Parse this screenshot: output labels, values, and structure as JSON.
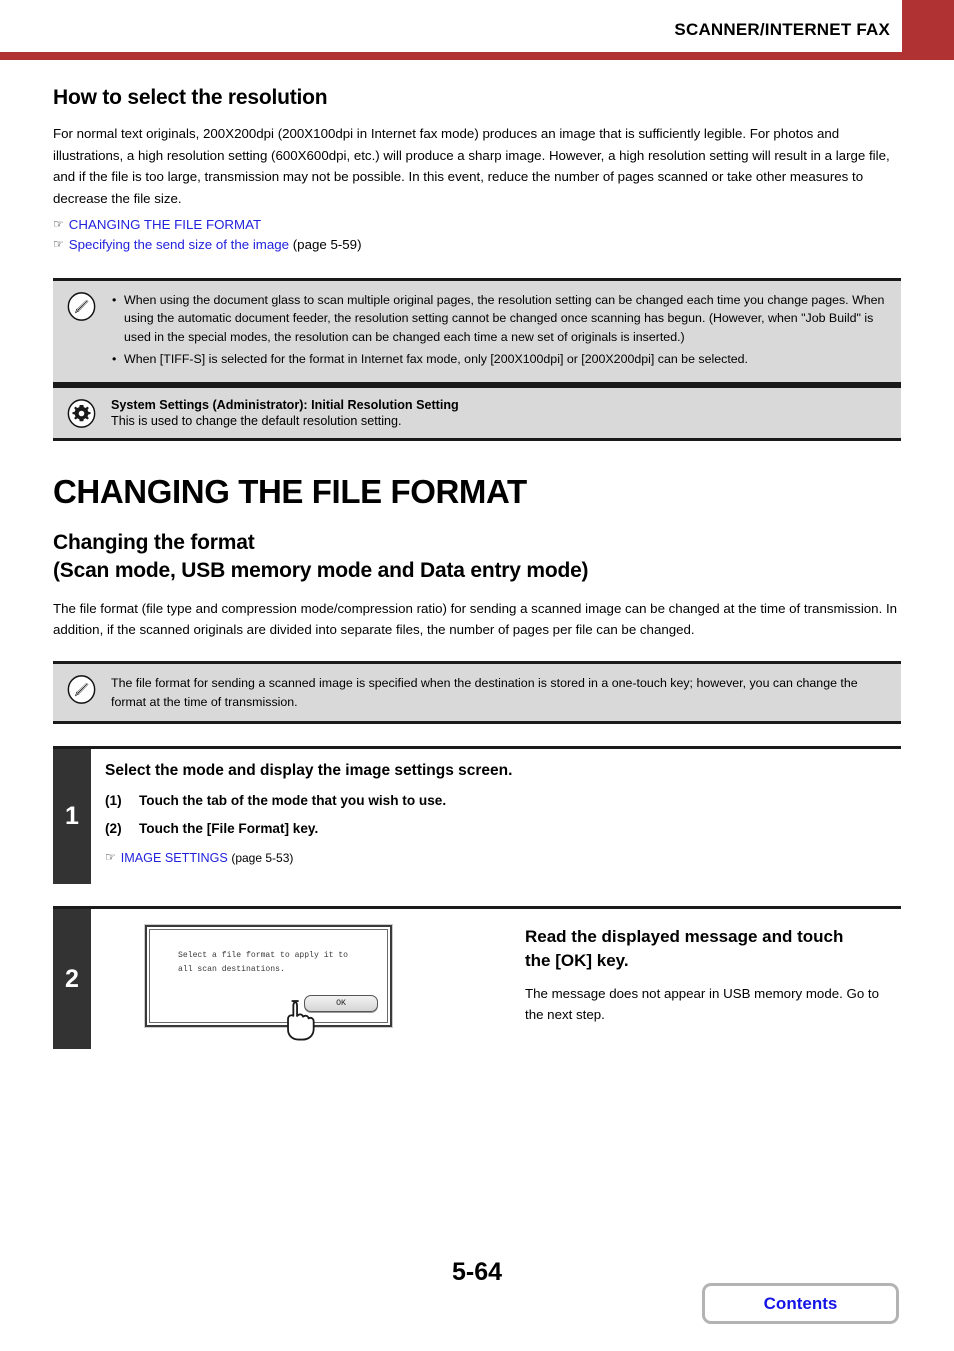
{
  "header": {
    "title": "SCANNER/INTERNET FAX",
    "accent_color": "#b03232"
  },
  "resolution_section": {
    "heading": "How to select the resolution",
    "paragraph": "For normal text originals, 200X200dpi (200X100dpi in Internet fax mode) produces an image that is sufficiently legible. For photos and illustrations, a high resolution setting (600X600dpi, etc.) will produce a sharp image. However, a high resolution setting will result in a large file, and if the file is too large, transmission may not be possible. In this event, reduce the number of pages scanned or take other measures to decrease the file size.",
    "links": [
      {
        "pointer": "☞",
        "label": "CHANGING THE FILE FORMAT",
        "page": ""
      },
      {
        "pointer": "☞",
        "label": "Specifying the send size of the image",
        "page": "(page 5-59)"
      }
    ]
  },
  "note_box_1": {
    "icon": "pencil-note-icon",
    "bullets": [
      "When using the document glass to scan multiple original pages, the resolution setting can be changed each time you change pages. When using the automatic document feeder, the resolution setting cannot be changed once scanning has begun. (However, when \"Job Build\" is used in the special modes, the resolution can be changed each time a new set of originals is inserted.)",
      "When [TIFF-S] is selected for the format in Internet fax mode, only [200X100dpi] or [200X200dpi] can be selected."
    ]
  },
  "admin_box": {
    "icon": "gear-icon",
    "title": "System Settings (Administrator): Initial Resolution Setting",
    "text": "This is used to change the default resolution setting."
  },
  "file_format_section": {
    "main_heading": "CHANGING THE FILE FORMAT",
    "sub_heading_line1": "Changing the format",
    "sub_heading_line2": "(Scan mode, USB memory mode and Data entry mode)",
    "paragraph": "The file format (file type and compression mode/compression ratio) for sending a scanned image can be changed at the time of transmission. In addition, if the scanned originals are divided into separate files, the number of pages per file can be changed."
  },
  "note_box_2": {
    "icon": "pencil-note-icon",
    "text": "The file format for sending a scanned image is specified when the destination is stored in a one-touch key; however, you can change the format at the time of transmission."
  },
  "steps": [
    {
      "number": "1",
      "heading": "Select the mode and display the image settings screen.",
      "substeps": [
        {
          "index": "(1)",
          "text": "Touch the tab of the mode that you wish to use."
        },
        {
          "index": "(2)",
          "text": "Touch the [File Format] key."
        }
      ],
      "link": {
        "pointer": "☞",
        "label": "IMAGE SETTINGS",
        "page": "(page 5-53)"
      }
    },
    {
      "number": "2",
      "heading_line1": "Read the displayed message and touch",
      "heading_line2": "the [OK] key.",
      "paragraph": "The message does not appear in USB memory mode. Go to the next step.",
      "figure": {
        "screen_message": "Select a file format to apply it to\nall scan destinations.",
        "ok_label": "OK",
        "cursor": "pointing-hand-icon"
      }
    }
  ],
  "footer": {
    "page_number": "5-64",
    "contents_label": "Contents",
    "contents_color": "#1414e6"
  }
}
